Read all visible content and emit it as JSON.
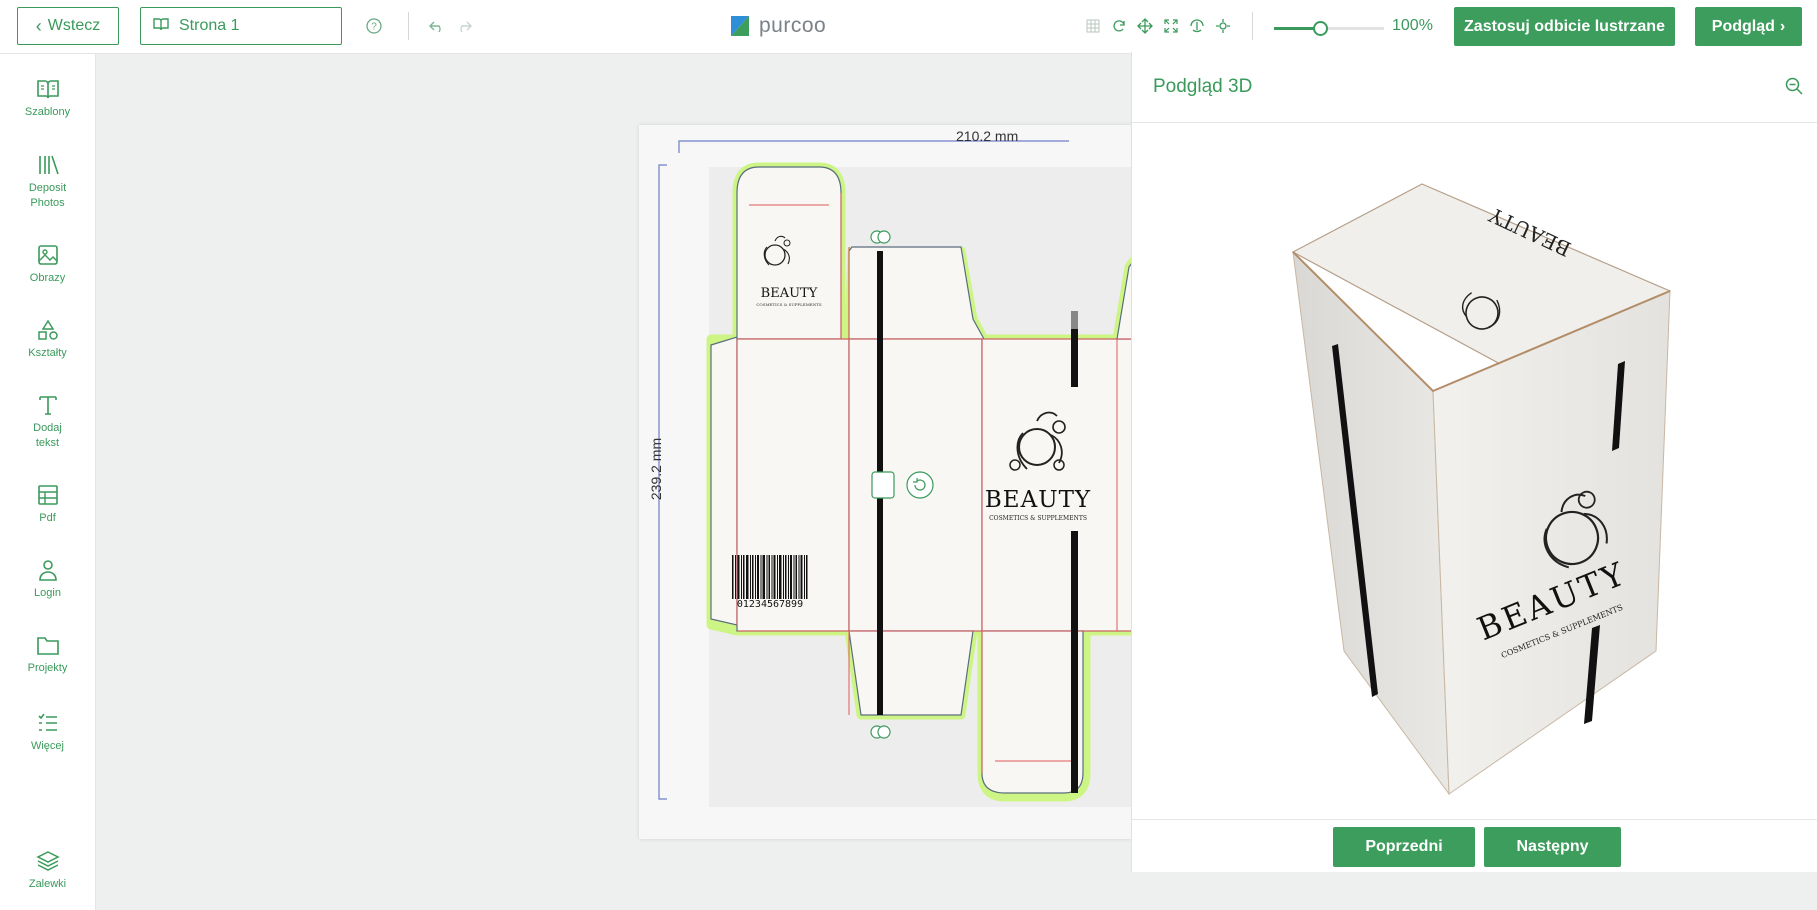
{
  "topbar": {
    "back_label": "Wstecz",
    "page_label": "Strona 1",
    "logo_text": "purcoo",
    "zoom_value": "100%",
    "zoom_fraction": 0.42,
    "mirror_label": "Zastosuj odbicie lustrzane",
    "preview_label": "Podgląd"
  },
  "sidebar": {
    "items": [
      {
        "label": "Szablony",
        "icon": "book-open-icon"
      },
      {
        "label": "Deposit Photos",
        "icon": "library-icon"
      },
      {
        "label": "Obrazy",
        "icon": "image-icon"
      },
      {
        "label": "Kształty",
        "icon": "shapes-icon"
      },
      {
        "label": "Dodaj tekst",
        "icon": "text-icon"
      },
      {
        "label": "Pdf",
        "icon": "table-icon"
      },
      {
        "label": "Login",
        "icon": "user-icon"
      },
      {
        "label": "Projekty",
        "icon": "folder-icon"
      },
      {
        "label": "Więcej",
        "icon": "list-icon"
      }
    ],
    "layers_label": "Zalewki"
  },
  "canvas": {
    "width_dim": "210.2 mm",
    "height_dim": "239.2 mm",
    "brand": "BEAUTY",
    "tagline": "COSMETICS & SUPPLEMENTS",
    "barcode_number": "01234567899"
  },
  "preview3d": {
    "title": "Podgląd 3D",
    "prev_label": "Poprzedni",
    "next_label": "Następny"
  },
  "colors": {
    "accent": "#3c9d5c",
    "bleed": "#c9f27a",
    "cutline": "#e05a5a"
  }
}
